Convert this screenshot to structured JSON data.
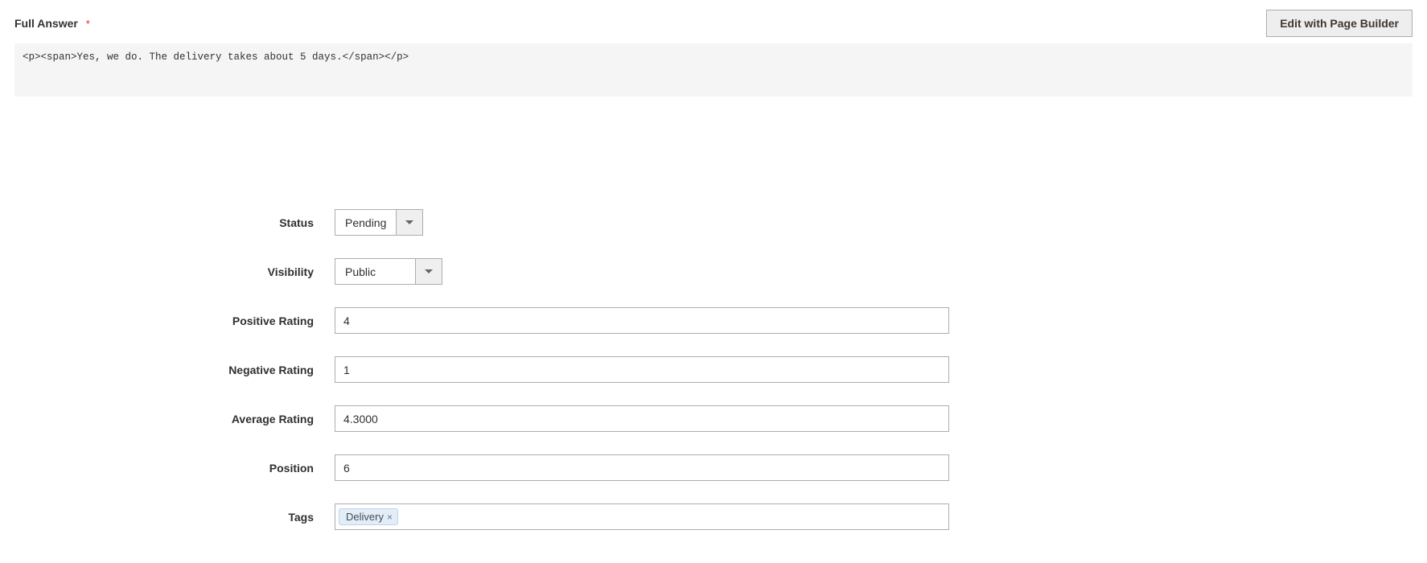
{
  "section": {
    "full_answer_label": "Full Answer",
    "edit_button": "Edit with Page Builder",
    "code_content": "<p><span>Yes, we do. The delivery takes about 5 days.</span></p>"
  },
  "fields": {
    "status": {
      "label": "Status",
      "value": "Pending"
    },
    "visibility": {
      "label": "Visibility",
      "value": "Public"
    },
    "positive_rating": {
      "label": "Positive Rating",
      "value": "4"
    },
    "negative_rating": {
      "label": "Negative Rating",
      "value": "1"
    },
    "average_rating": {
      "label": "Average Rating",
      "value": "4.3000"
    },
    "position": {
      "label": "Position",
      "value": "6"
    },
    "tags": {
      "label": "Tags",
      "items": [
        "Delivery"
      ]
    }
  }
}
